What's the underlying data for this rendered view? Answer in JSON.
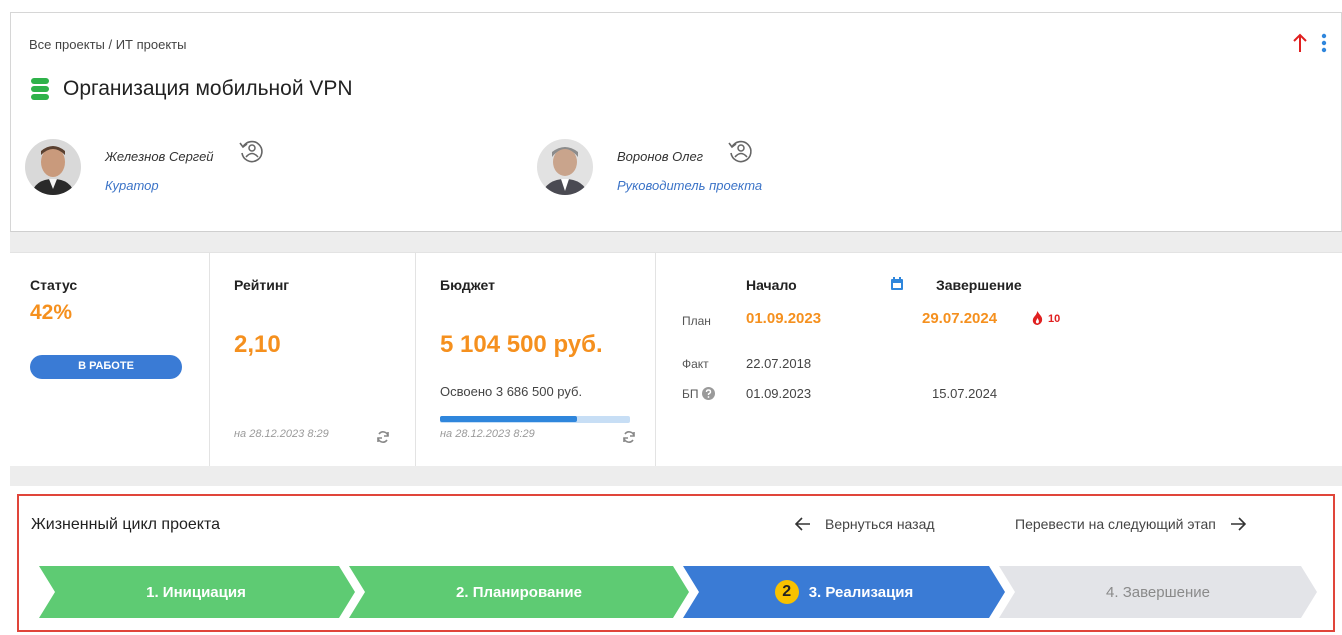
{
  "breadcrumb": "Все проекты / ИТ проекты",
  "title": "Организация мобильной VPN",
  "people": [
    {
      "name": "Железнов Сергей",
      "role": "Куратор"
    },
    {
      "name": "Воронов Олег",
      "role": "Руководитель проекта"
    }
  ],
  "status": {
    "label": "Статус",
    "percent": "42%",
    "badge": "В РАБОТЕ"
  },
  "rating": {
    "label": "Рейтинг",
    "value": "2,10",
    "stamp": "на 28.12.2023 8:29"
  },
  "budget": {
    "label": "Бюджет",
    "value": "5 104 500 руб.",
    "mastered": "Освоено  3 686 500 руб.",
    "mastered_fraction": 0.72,
    "stamp": "на 28.12.2023 8:29"
  },
  "dates": {
    "start_header": "Начало",
    "end_header": "Завершение",
    "plan_label": "План",
    "fact_label": "Факт",
    "bp_label": "БП",
    "plan_start": "01.09.2023",
    "plan_end": "29.07.2024",
    "overdue_days": "10",
    "fact_start": "22.07.2018",
    "bp_start": "01.09.2023",
    "bp_end": "15.07.2024"
  },
  "lifecycle": {
    "title": "Жизненный цикл проекта",
    "back_label": "Вернуться назад",
    "next_label": "Перевести на следующий этап",
    "stages": [
      {
        "label": "1. Инициация",
        "state": "done"
      },
      {
        "label": "2. Планирование",
        "state": "done"
      },
      {
        "label": "3. Реализация",
        "state": "current",
        "badge": "2"
      },
      {
        "label": "4. Завершение",
        "state": "pending"
      }
    ]
  },
  "colors": {
    "accent_orange": "#f5901e",
    "blue": "#3a7bd5",
    "green": "#5ecb73",
    "red_border": "#e0453a",
    "gray_stage": "#e3e4e8"
  }
}
